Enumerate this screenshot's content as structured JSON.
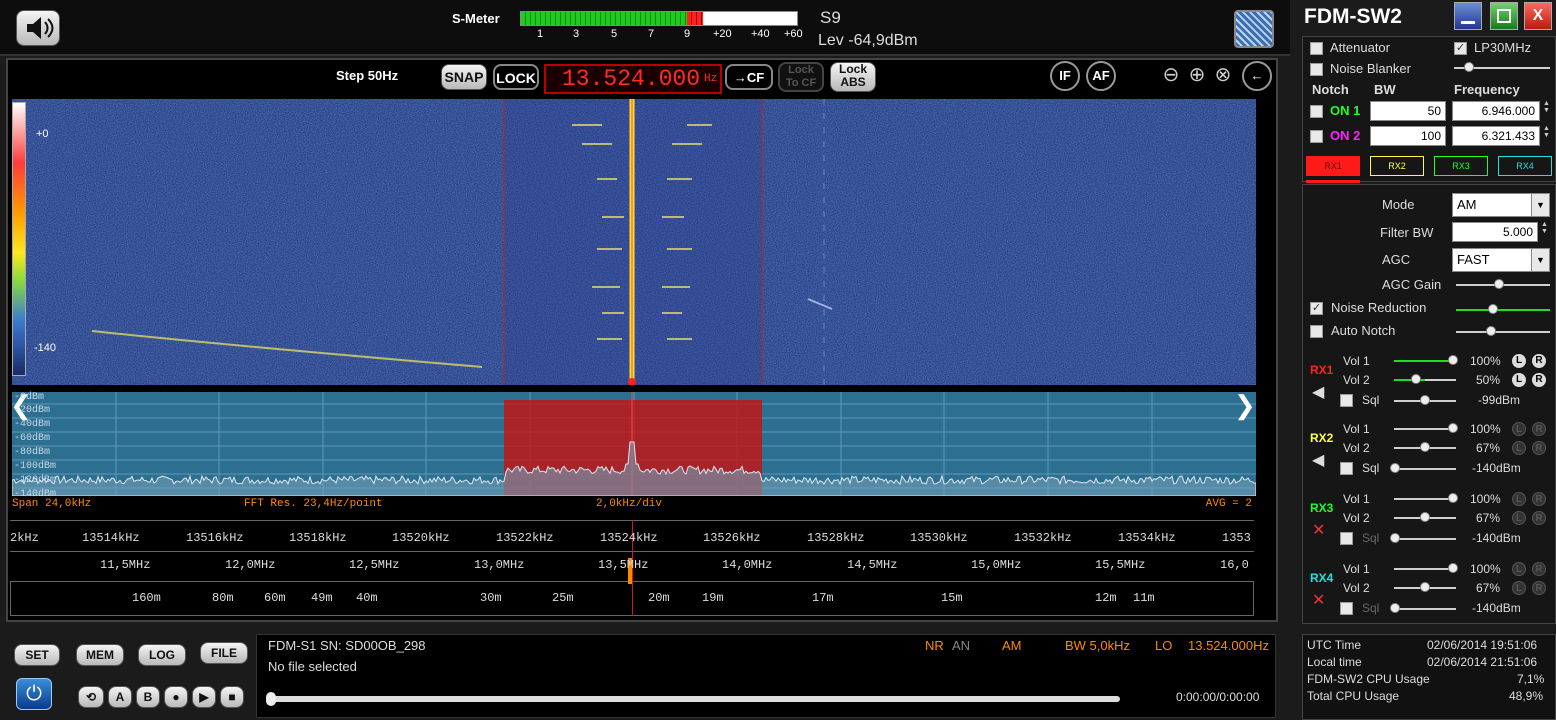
{
  "topbar": {
    "smeter_label": "S-Meter",
    "smeter_ticks": [
      "1",
      "3",
      "5",
      "7",
      "9",
      "+20",
      "+40",
      "+60"
    ],
    "s_value": "S9",
    "level": "Lev -64,9dBm",
    "smeter_level_fraction": 0.64
  },
  "controls": {
    "step": "Step 50Hz",
    "snap": "SNAP",
    "lock": "LOCK",
    "frequency": "13.524.000",
    "freq_unit": "Hz",
    "to_cf": "→CF",
    "lock_to_cf": [
      "Lock",
      "To CF"
    ],
    "lock_abs": [
      "Lock",
      "ABS"
    ],
    "if": "IF",
    "af": "AF"
  },
  "waterfall": {
    "scale_top": "+0",
    "scale_bottom": "-140"
  },
  "spectrum": {
    "db_labels": [
      "-0dBm",
      "-20dBm",
      "-40dBm",
      "-60dBm",
      "-80dBm",
      "-100dBm",
      "-120dBm",
      "-140dBm"
    ],
    "span": "Span 24,0kHz",
    "fft_res": "FFT Res. 23,4Hz/point",
    "div": "2,0kHz/div",
    "avg": "AVG = 2"
  },
  "scales": {
    "khz": [
      "2kHz",
      "13514kHz",
      "13516kHz",
      "13518kHz",
      "13520kHz",
      "13522kHz",
      "13524kHz",
      "13526kHz",
      "13528kHz",
      "13530kHz",
      "13532kHz",
      "13534kHz",
      "1353"
    ],
    "mhz": [
      "11,5MHz",
      "12,0MHz",
      "12,5MHz",
      "13,0MHz",
      "13,5MHz",
      "14,0MHz",
      "14,5MHz",
      "15,0MHz",
      "15,5MHz",
      "16,0"
    ],
    "meters": [
      "160m",
      "80m",
      "60m",
      "49m",
      "40m",
      "30m",
      "25m",
      "20m",
      "19m",
      "17m",
      "15m",
      "12m",
      "11m"
    ]
  },
  "right_panel": {
    "title": "FDM-SW2",
    "close": "X",
    "attenuator": "Attenuator",
    "lp30": "LP30MHz",
    "noise_blanker": "Noise Blanker",
    "notch_header": "Notch",
    "bw_header": "BW",
    "freq_header": "Frequency",
    "on1": "ON 1",
    "on2": "ON 2",
    "bw1": "50",
    "bw2": "100",
    "freq1": "6.946.000",
    "freq2": "6.321.433",
    "rx_tabs": [
      "RX1",
      "RX2",
      "RX3",
      "RX4"
    ],
    "mode_label": "Mode",
    "mode_value": "AM",
    "filterbw_label": "Filter BW",
    "filterbw_value": "5.000",
    "agc_label": "AGC",
    "agc_value": "FAST",
    "agc_gain_label": "AGC Gain",
    "noise_reduction": "Noise Reduction",
    "auto_notch": "Auto Notch",
    "rx": [
      {
        "name": "RX1",
        "vol1": "Vol 1",
        "vol1_pct": "100%",
        "vol1_level": 1.0,
        "vol2": "Vol 2",
        "vol2_pct": "50%",
        "vol2_level": 0.5,
        "sql": "Sql",
        "sql_val": "-99dBm"
      },
      {
        "name": "RX2",
        "vol1": "Vol 1",
        "vol1_pct": "100%",
        "vol1_level": 1.0,
        "vol2": "Vol 2",
        "vol2_pct": "67%",
        "vol2_level": 0.67,
        "sql": "Sql",
        "sql_val": "-140dBm"
      },
      {
        "name": "RX3",
        "vol1": "Vol 1",
        "vol1_pct": "100%",
        "vol1_level": 1.0,
        "vol2": "Vol 2",
        "vol2_pct": "67%",
        "vol2_level": 0.67,
        "sql": "Sql",
        "sql_val": "-140dBm"
      },
      {
        "name": "RX4",
        "vol1": "Vol 1",
        "vol1_pct": "100%",
        "vol1_level": 1.0,
        "vol2": "Vol 2",
        "vol2_pct": "67%",
        "vol2_level": 0.67,
        "sql": "Sql",
        "sql_val": "-140dBm"
      }
    ],
    "colors": {
      "rx1": "#ff2020",
      "rx2": "#ffff40",
      "rx3": "#20ff20",
      "rx4": "#20e0e0",
      "on1": "#20ff20",
      "on2": "#ff20ff"
    }
  },
  "bottom": {
    "set": "SET",
    "mem": "MEM",
    "log": "LOG",
    "file": "FILE",
    "device": "FDM-S1 SN: SD00OB_298",
    "no_file": "No file selected",
    "nr": "NR",
    "an": "AN",
    "am": "AM",
    "bw": "BW 5,0kHz",
    "lo": "LO",
    "lo_value": "13.524.000Hz",
    "time_display": "0:00:00/0:00:00",
    "utc_label": "UTC Time",
    "utc_value": "02/06/2014 19:51:06",
    "local_label": "Local time",
    "local_value": "02/06/2014 21:51:06",
    "cpu_label": "FDM-SW2 CPU Usage",
    "cpu_value": "7,1%",
    "total_cpu_label": "Total CPU Usage",
    "total_cpu_value": "48,9%"
  }
}
